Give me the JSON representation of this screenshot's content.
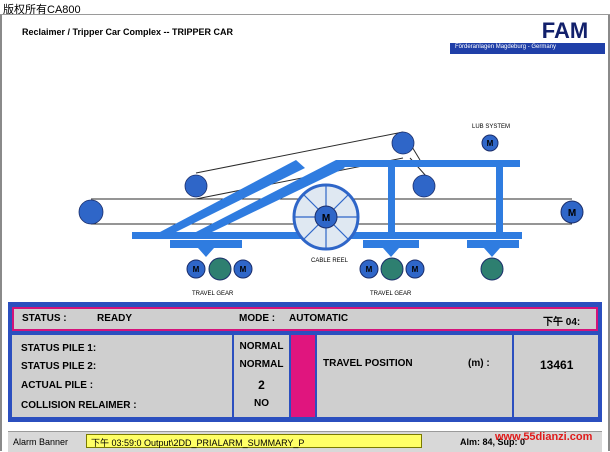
{
  "window": {
    "caption": "版权所有CA800"
  },
  "header": {
    "title": "Reclaimer / Tripper Car Complex  --  TRIPPER CAR",
    "logo_text": "FAM",
    "logo_subtitle": "Förderanlagen Magdeburg - Germany"
  },
  "diagram": {
    "lub_system_label": "LUB SYSTEM",
    "cable_reel_label": "CABLE REEL",
    "travel_gear_left_label": "TRAVEL GEAR",
    "travel_gear_right_label": "TRAVEL GEAR",
    "motor_symbol": "M",
    "colors": {
      "belt_blue": "#2f66c8",
      "structure_blue": "#2f7ce0",
      "motor_teal": "#2e7f70",
      "reel_light": "#dfe8f2"
    }
  },
  "status": {
    "status_label": "STATUS :",
    "status_value": "READY",
    "mode_label": "MODE :",
    "mode_value": "AUTOMATIC",
    "time_value": "下午 04:",
    "rows": [
      {
        "label": "STATUS PILE  1:",
        "value": "NORMAL"
      },
      {
        "label": "STATUS PILE  2:",
        "value": "NORMAL"
      },
      {
        "label": "ACTUAL PILE :",
        "value": "2"
      },
      {
        "label": "COLLISION RELAIMER :",
        "value": "NO"
      }
    ],
    "travel_position_label": "TRAVEL POSITION",
    "travel_unit": "(m) :",
    "travel_value": "13461",
    "colors": {
      "panel": "#2b4fbf",
      "accent": "#e0157e",
      "box": "#cfcfcf"
    }
  },
  "alarm": {
    "label": "Alarm Banner",
    "message": "下午 03:59:0 Output\\2DD_PRIALARM_SUMMARY_P",
    "count_text": "Alm:  84, Sup:  0"
  },
  "watermark": "www.55dianzi.com"
}
